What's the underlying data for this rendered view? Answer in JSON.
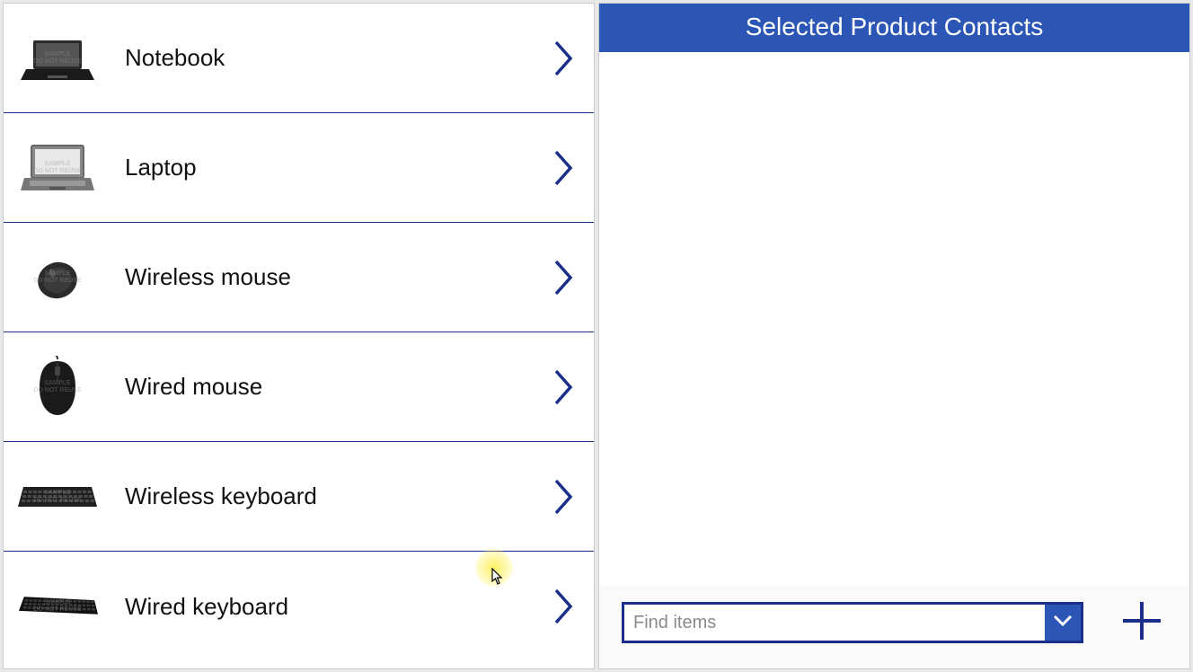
{
  "products": [
    {
      "label": "Notebook",
      "icon": "notebook"
    },
    {
      "label": "Laptop",
      "icon": "laptop"
    },
    {
      "label": "Wireless mouse",
      "icon": "mouse-wireless"
    },
    {
      "label": "Wired mouse",
      "icon": "mouse-wired"
    },
    {
      "label": "Wireless keyboard",
      "icon": "keyboard-wireless"
    },
    {
      "label": "Wired keyboard",
      "icon": "keyboard-wired"
    }
  ],
  "rightPane": {
    "title": "Selected Product Contacts"
  },
  "search": {
    "placeholder": "Find items"
  },
  "watermark_text": "SAMPLE\nDO NOT REUSE"
}
